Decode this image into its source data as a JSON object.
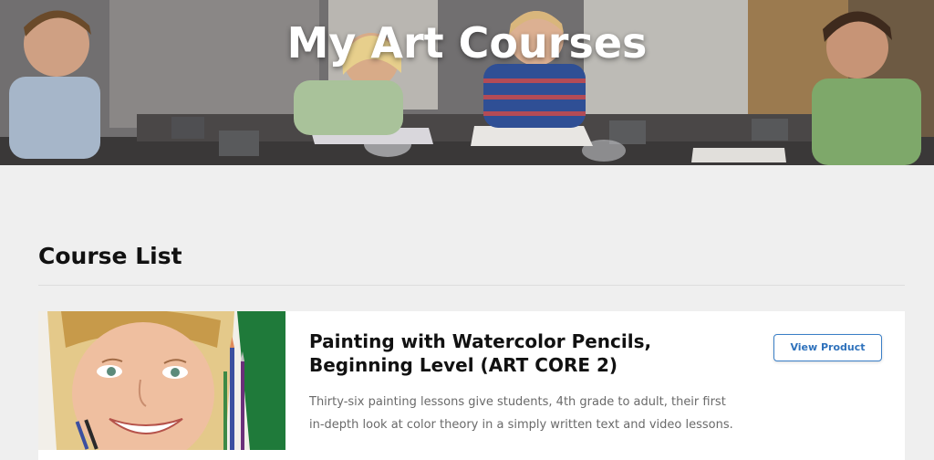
{
  "hero": {
    "title": "My Art Courses",
    "image_alt": "children painting at a classroom table"
  },
  "course_list": {
    "heading": "Course List",
    "courses": [
      {
        "title_line1": "Painting with Watercolor Pencils,",
        "title_line2": "Beginning Level (ART CORE 2)",
        "description": "Thirty-six painting lessons give students, 4th grade to adult, their first in-depth look at color theory in a simply written text and video lessons.",
        "button_label": "View Product",
        "thumbnail_alt": "watercolor pencil portrait of a smiling girl with brushes and pencils"
      }
    ]
  },
  "colors": {
    "page_bg": "#efefef",
    "card_bg": "#ffffff",
    "accent": "#3a7fc7",
    "title_text": "#111111",
    "body_text": "#6a6a6a"
  }
}
